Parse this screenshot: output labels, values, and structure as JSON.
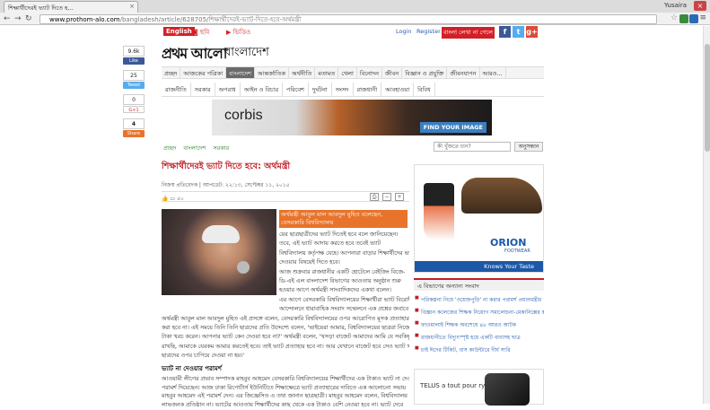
{
  "browser": {
    "tab_title": "শিক্ষার্থীদেরই ভ্যাট দিতে হ...",
    "user": "Yusaira",
    "url_host": "www.prothom-alo.com",
    "url_path": "/bangladesh/article/628705/শিক্ষার্থীদেরই-ভ্যাট-দিতে-হবে-অর্থমন্ত্রী"
  },
  "share": {
    "fb_count": "9.6k",
    "fb_label": "Like",
    "tw_count": "25",
    "tw_label": "Tweet",
    "gp_count": "0",
    "gp_label": "G+1",
    "other_count": "4",
    "other_label": "Share"
  },
  "header": {
    "english": "English",
    "photo": "ছবি",
    "video": "ভিডিও",
    "login": "Login",
    "register": "Register",
    "bangla_typing": "বাংলা লেখা না গেলে",
    "logo": "প্রথম আলো",
    "section": "বাংলাদেশ"
  },
  "nav1": [
    "প্রচ্ছদ",
    "আজকের পত্রিকা",
    "বাংলাদেশ",
    "আন্তর্জাতিক",
    "অর্থনীতি",
    "মতামত",
    "খেলা",
    "বিনোদন",
    "জীবন",
    "বিজ্ঞান ও প্রযুক্তি",
    "জীবনযাপন",
    "আরও..."
  ],
  "nav1_active": 2,
  "nav2": [
    "রাজনীতি",
    "সরকার",
    "অপরাধ",
    "আইন ও বিচার",
    "পরিবেশ",
    "দুর্ঘটনা",
    "সংসদ",
    "রাজধানী",
    "আবহাওয়া",
    "বিবিধ"
  ],
  "banner": {
    "brand": "corbis",
    "cta": "FIND YOUR IMAGE"
  },
  "breadcrumb": [
    "প্রচ্ছদ",
    "বাংলাদেশ",
    "সরকার"
  ],
  "search": {
    "placeholder": "কী খুঁজতে চান?",
    "button": "অনুসন্ধান"
  },
  "article": {
    "headline": "শিক্ষার্থীদেরই ভ্যাট দিতে হবে: অর্থমন্ত্রী",
    "byline": "নিজস্ব প্রতিবেদক | আপডেট: ২২:১৩, সেপ্টেম্বর ১১, ২০১৫",
    "comments": "৫০",
    "highlight": "অর্থমন্ত্রী আবুল মাল আবদুল মুহিত বলেছেন, বেসরকারি বিশ্ববিদ্যালয়",
    "lines": [
      "য়ের ছাত্রছাত্রীদের ভ্যাট দিতেই হবে বলে জানিয়েছেন।",
      "তবে, এই ভ্যাট আদায় করতে হবে তবেই ভ্যাট",
      "বিশ্ববিদ্যালয় কর্তৃপক্ষ যেহে। আপনারা বাড়ার শিক্ষার্থীদের ভ্যাট",
      "দেওয়ার বিষয়েই দিতে হবে।",
      "আজ শুক্রবার রাজধানীর একটি হোটেলে বেইজিং বিজে-",
      "ডি-এই এল বাংলাদেশ বিভাগের আওতায় অনুষ্ঠান শুরু",
      "হওয়ার আগে অর্থমন্ত্রী সাংবাদিকদের একথা বলেন।",
      "এর আগে বেসরকারি বিশ্ববিদ্যালয়ের শিক্ষার্থীরা ভ্যাট বিরোধী",
      "আন্দোলনে ধারাবাহিক সংবাদ সম্মেলনে এক প্রশ্নের জবাবে",
      "অর্থমন্ত্রী আবুল মাল আবদুল মুহিত এই প্রসঙ্গে বলেন, বেসরকারি বিশ্ববিদ্যালয়ের ওপর আরোপিত মূসক প্রত্যাহার",
      "করা হবে না। এই সময়ে তিনি তিনি ছাত্রদের প্রতি উদ্দেশ্যে বলেন, 'ভাইয়েরা আমার, বিশ্ববিদ্যালয়ের ছাত্ররা নিজেরাই এক হাজার",
      "টাকা খরচ করেন। আপনার ভ্যাট কেন দেওয়া হবে না?' অর্থমন্ত্রী বলেন, 'খসড়া বাজেট আমাদের আমি যে সবকিছু",
      "রাখছি, আমাকে যেরকম আমার করতেই হবে। তাই ভ্যাট প্রত্যাহার হবে না। আর যেখানে বাজেট হবে সেও ভ্যাট থাকবে",
      "ছাত্রদের ওপর চাপিয়ে দেওয়া না হয়।'"
    ],
    "subhead": "ভ্যাট না দেওয়ার পরামর্শ",
    "lines2": [
      "আওয়ামী লীগের প্রভাব সম্পাদক মাহবুব আহমেদ বেসরকারি বিশ্ববিদ্যালয়ের শিক্ষার্থীদের এক টাকাও ভ্যাট না দেওয়ার",
      "পরামর্শ দিয়েছেন। আজ ঢাকা রিপোর্টার্স ইউনিটিতে শিক্ষাক্ষেত্রে ভ্যাট প্রত্যাহারের দাবিতে এক আলোচনা সভায়",
      "মাহবুব আহমেদ এই পরামর্শ দেন। এর জিজ্ঞেসিত এ তথ্য জানান ছাত্রছাত্রী। মাহবুব আহমেদ বলেন, বিশ্ববিদ্যালয় কোনো",
      "লাভজনক প্রতিষ্ঠান না। ভ্যাটের আওতায় শিক্ষার্থীদের কাছ থেকে এক টাকাও বেশি নেওয়া হবে না। ভ্যাট দেবে"
    ]
  },
  "ad_shoe": {
    "brand": "ORION",
    "sub": "FOOTWEAR",
    "cta": "Knows Your Taste"
  },
  "related": {
    "title": "এ বিভাগের অন্যান্য সংবাদ",
    "items": [
      "পরিকল্পনা নিয়ে 'ওয়েজপুড়ি' না করার পরামর্শ প্রধানমন্ত্রীর",
      "বিজ্ঞান কলেজের শিক্ষক নিয়োগ সমালোচনা-মেকানিক্সের কাছে ৪",
      "ফাওমালাই শিক্ষক অবশেষে ৪৮ আরও আটক",
      "রাজধানীতে বিদ্যুৎস্পৃষ্ট হয়ে একটি বাবাসহ ছাত্র",
      "চাই ঈদের টিকিট, বাস কাউন্টারে দীর্ঘ সারি"
    ]
  },
  "ad_telus": {
    "text": "TELUS a tout pour rythmer"
  }
}
